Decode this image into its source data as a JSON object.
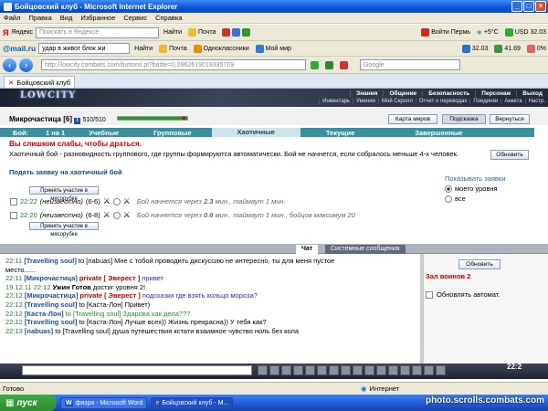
{
  "window": {
    "title": "Бойцовский клуб - Microsoft Internet Explorer"
  },
  "menu": [
    "Файл",
    "Правка",
    "Вид",
    "Избранное",
    "Сервис",
    "Справка"
  ],
  "toolbar1": {
    "yandex_search_placeholder": "Поискать в Яндексе",
    "find_label": "Найти",
    "mail_label": "Почта",
    "mailru_logo": "@mail.ru",
    "mailru_search": "удар в живот блок жи",
    "mailru_find": "Найти",
    "pochta": "Почта",
    "odnoklassniki": "Одноклассники",
    "moy_mir": "Мой мир",
    "enter_perm": "Войти Пермь",
    "temp": "+5°C",
    "usd": "USD 32.03"
  },
  "toolbar2": {
    "rate1": "32.03",
    "rate2": "41.69",
    "rate3": "0%"
  },
  "address": {
    "url": "http://lowcity.combats.com/buttons.pl?battle=0.09626190193357​69",
    "search_placeholder": "Google"
  },
  "page_tab": {
    "title": "Бойцовский клуб"
  },
  "game": {
    "logo": "LOWCITY",
    "menu_top": [
      "Знания",
      "Общение",
      "Безопасность",
      "Персонаж",
      "Выход"
    ],
    "menu_bottom": [
      "Инвентарь",
      "Умения",
      "Мой Скролл",
      "Отчет о переводах",
      "Поединки",
      "Анкета",
      "Настр."
    ],
    "char_name": "Микрочастица",
    "char_level": "[6]",
    "hp_text": "510/510",
    "hp_fraction": 1.0,
    "buttons": {
      "map": "Карта миров",
      "hint": "Подсказка",
      "back": "Вернуться"
    },
    "battle_label": "Бой:",
    "battle_tabs": [
      "1 на 1",
      "Учебные",
      "Групповые",
      "Хаотичные",
      "Текущие",
      "Завершенные"
    ],
    "active_tab": "Хаотичные",
    "warning": "Вы слишком слабы, чтобы драться.",
    "description": "Хаотичный бой - разновидность группового, где группы формируются автоматически. Бой не начнется, если собралось меньше 4-х человек.",
    "refresh": "Обновить",
    "apply_title": "Подать заявку на хаотичный бой",
    "show_requests": {
      "title": "Показывать заявки",
      "opt1": "моего уровня",
      "opt2": "все"
    },
    "join_button": "Принять участие в мясорубке",
    "requests": [
      {
        "time": "22:22",
        "who": "(неизвестно)",
        "range": "(6-6)",
        "info_pre": "Бой начнется через",
        "minutes": "2.3",
        "info_post": "мин., таймаут 1 мин."
      },
      {
        "time": "22:20",
        "who": "(неизвестно)",
        "range": "(6-8)",
        "info_pre": "Бой начнется через",
        "minutes": "0.6",
        "info_post": "мин., таймаут 1 мин., бойцов максимум 20"
      }
    ],
    "chat_tabs": {
      "chat": "Чат",
      "system": "Системные сообщения"
    },
    "chat": [
      {
        "time": "22:11",
        "name": "[Travelling soul]",
        "to": "to [nabuas]",
        "text": "Мне с тобой проводить дискуссию не интересно, ты для меня пустое"
      },
      {
        "time": "",
        "name": "",
        "to": "",
        "text": "место......"
      },
      {
        "time": "22:11",
        "name": "[Микрочастица]",
        "priv": "private [ Эверест ]",
        "text": "привет"
      },
      {
        "time": "19.12.11",
        "time2": "22:12",
        "name": "Ужин Готов",
        "text": "достиг уровня 2!"
      },
      {
        "time": "22:12",
        "name": "[Микрочастица]",
        "priv": "private [ Эверест ]",
        "text": "подсказки где взять кольцо мороза?"
      },
      {
        "time": "22:12",
        "name": "[Travelling soul]",
        "to": "to [Каста-Лон]",
        "text": "Привет)"
      },
      {
        "time": "22:12",
        "name": "[Каста-Лон]",
        "to": "to [Travelling soul]",
        "text": "Здарова как дела???"
      },
      {
        "time": "22:12",
        "name": "[Travelling soul]",
        "to": "to [Каста-Лон]",
        "text": "Лучше всех)) Жизнь прекрасна)) У тебя как?"
      },
      {
        "time": "22:13",
        "name": "[nabuas]",
        "to": "to [Travelling soul]",
        "text": "душа путешествия кстати взаимное чувство ноль без кола"
      }
    ],
    "right_panel": {
      "refresh": "Обновить",
      "hall": "Зал воинов 2",
      "auto": "Обновлять автомат."
    },
    "clock": "22:2"
  },
  "statusbar": {
    "ready": "Готово",
    "zone": "Интернет"
  },
  "taskbar": {
    "start": "пуск",
    "tasks": [
      "физра - Microsoft Word",
      "Бойцовский клуб - M..."
    ]
  },
  "watermark": "photo.scrolls.combats.com"
}
